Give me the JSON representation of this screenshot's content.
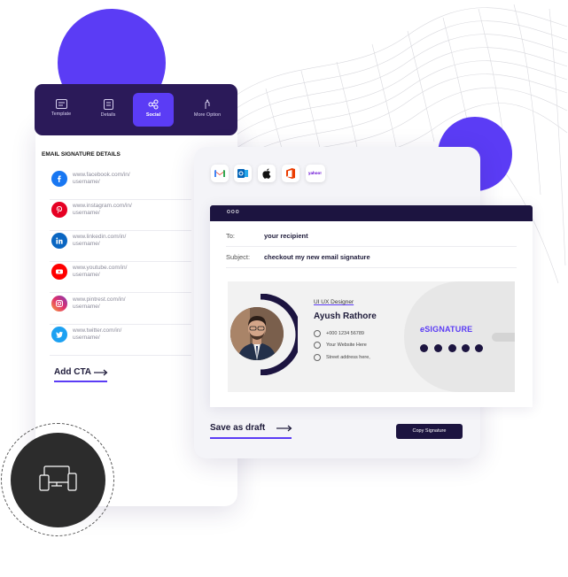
{
  "colors": {
    "accent": "#5b3cf5",
    "navy": "#1c1440",
    "panel_dark": "#2b1a59"
  },
  "tabs": [
    {
      "label": "Template",
      "icon": "template-icon"
    },
    {
      "label": "Details",
      "icon": "details-icon"
    },
    {
      "label": "Social",
      "icon": "social-icon",
      "active": true
    },
    {
      "label": "More Option",
      "icon": "more-option-icon"
    }
  ],
  "section_title": "EMAIL SIGNATURE DETAILS",
  "social_links": [
    {
      "network": "facebook",
      "line1": "www.facebook.com/in/",
      "line2": "username/",
      "color": "#1877f2"
    },
    {
      "network": "pinterest",
      "line1": "www.instagram.com/in/",
      "line2": "username/",
      "color": "#e60023"
    },
    {
      "network": "linkedin",
      "line1": "www.linkedin.com/in/",
      "line2": "username/",
      "color": "#0a66c2"
    },
    {
      "network": "youtube",
      "line1": "www.youtube.com/in/",
      "line2": "username/",
      "color": "#ff0000"
    },
    {
      "network": "instagram",
      "line1": "www.pintrest.com/in/",
      "line2": "username/",
      "color": "#c13584"
    },
    {
      "network": "twitter",
      "line1": "www.twitter.com/in/",
      "line2": "username/",
      "color": "#1da1f2"
    }
  ],
  "add_cta_label": "Add CTA",
  "mail_clients": [
    "gmail-icon",
    "outlook-icon",
    "apple-mail-icon",
    "office-icon",
    "yahoo-icon"
  ],
  "yahoo_label": "yahoo!",
  "email": {
    "window_dots": "ooo",
    "to_label": "To:",
    "to_value": "your recipient",
    "subject_label": "Subject:",
    "subject_value": "checkout my new email signature"
  },
  "signature": {
    "role": "UI UX Designer",
    "first_name": "Ayush",
    "last_name": "Rathore",
    "phone": "+000 1234 56789",
    "website": "Your Website Here",
    "address": "Street address here,",
    "brand_prefix": "e",
    "brand_name": "SIGNATURE"
  },
  "save_draft_label": "Save as draft",
  "copy_signature_label": "Copy Signature"
}
